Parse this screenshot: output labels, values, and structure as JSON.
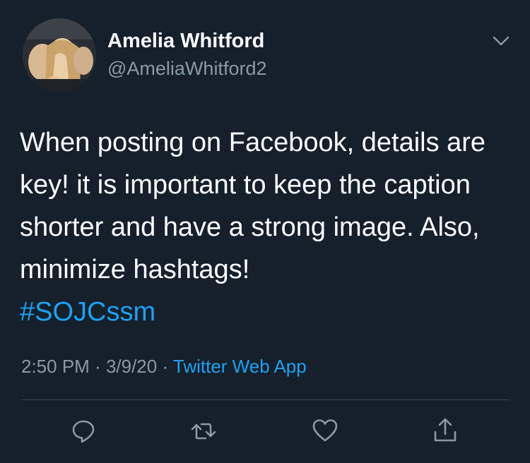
{
  "user": {
    "display_name": "Amelia Whitford",
    "handle": "@AmeliaWhitford2"
  },
  "tweet": {
    "text": "When posting on Facebook, details are key! it is important to keep the caption shorter and have a strong image. Also, minimize hashtags! ",
    "hashtag": "#SOJCssm"
  },
  "meta": {
    "time": "2:50 PM",
    "separator1": " · ",
    "date": "3/9/20",
    "separator2": " · ",
    "source": "Twitter Web App"
  },
  "icons": {
    "menu": "chevron-down-icon",
    "reply": "reply-icon",
    "retweet": "retweet-icon",
    "like": "heart-icon",
    "share": "share-icon"
  },
  "colors": {
    "background": "#15202b",
    "text": "#ffffff",
    "secondary": "#8899a6",
    "link": "#1da1f2",
    "divider": "#38444d"
  }
}
